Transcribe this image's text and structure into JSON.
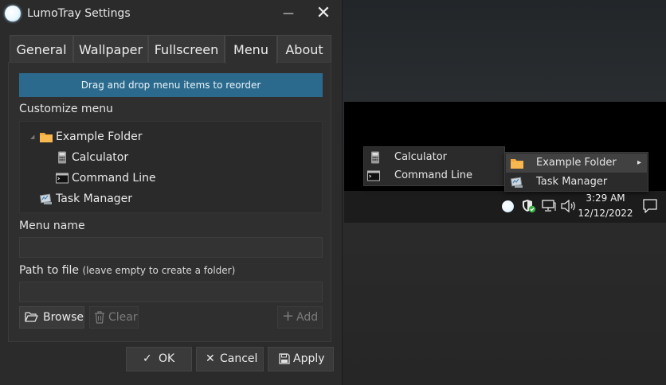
{
  "window": {
    "title": "LumoTray Settings",
    "minimize_glyph": "—",
    "close_glyph": "✕"
  },
  "tabs": [
    {
      "label": "General",
      "active": false
    },
    {
      "label": "Wallpaper",
      "active": false
    },
    {
      "label": "Fullscreen",
      "active": false
    },
    {
      "label": "Menu",
      "active": true
    },
    {
      "label": "About",
      "active": false
    }
  ],
  "menu_tab": {
    "banner": "Drag and drop menu items to reorder",
    "customize_label": "Customize menu",
    "tree": [
      {
        "label": "Example Folder",
        "icon": "folder-icon"
      },
      {
        "label": "Calculator",
        "icon": "calculator-icon"
      },
      {
        "label": "Command Line",
        "icon": "command-line-icon"
      },
      {
        "label": "Task Manager",
        "icon": "task-manager-icon"
      }
    ],
    "menu_name_label": "Menu name",
    "menu_name_value": "",
    "path_label": "Path to file",
    "path_hint": "(leave empty to create a folder)",
    "path_value": "",
    "browse_label": "Browse",
    "clear_label": "Clear",
    "add_label": "Add"
  },
  "footer": {
    "ok_label": "OK",
    "cancel_label": "Cancel",
    "apply_label": "Apply"
  },
  "tray_menu": {
    "main_items": [
      {
        "label": "Example Folder",
        "icon": "folder-icon",
        "submenu_arrow": "▸",
        "highlighted": true
      },
      {
        "label": "Task Manager",
        "icon": "task-manager-icon"
      }
    ],
    "submenu_items": [
      {
        "label": "Calculator",
        "icon": "calculator-icon"
      },
      {
        "label": "Command Line",
        "icon": "command-line-icon"
      }
    ]
  },
  "taskbar": {
    "time": "3:29 AM",
    "date": "12/12/2022",
    "tray_icons": [
      "lumotray-icon",
      "security-shield-icon",
      "network-icon",
      "volume-icon",
      "notification-icon"
    ]
  },
  "colors": {
    "accent_banner": "#2b6a8c",
    "folder": "#f2a93b",
    "window_bg": "#2b2b2b",
    "shield_check": "#3cb043"
  }
}
